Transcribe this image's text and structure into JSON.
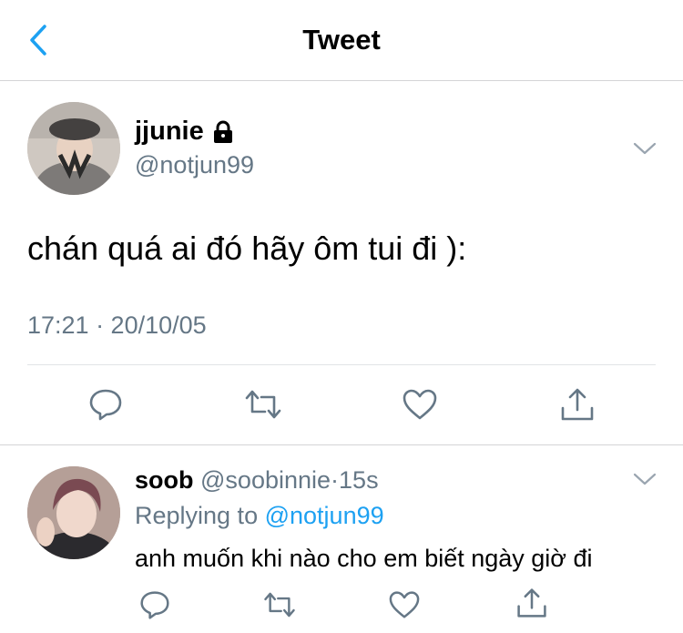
{
  "header": {
    "title": "Tweet",
    "back_icon": "chevron-left-icon"
  },
  "tweet": {
    "display_name": "jjunie",
    "handle": "@notjun99",
    "text": "chán quá ai đó hãy ôm tui đi ):",
    "timestamp": "17:21 · 20/10/05",
    "icons": [
      "lock-icon",
      "chevron-down-icon",
      "reply-icon",
      "retweet-icon",
      "like-icon",
      "share-icon"
    ]
  },
  "reply": {
    "display_name": "soob",
    "handle": "@soobinnie",
    "separator": "·",
    "time": "15s",
    "replying_prefix": "Replying to",
    "replying_to": "@notjun99",
    "text": "anh muốn khi nào cho em biết ngày giờ đi"
  },
  "colors": {
    "accent": "#1da1f2",
    "secondary_text": "#657786",
    "icon": "#657786",
    "divider": "#e1e4e6"
  }
}
